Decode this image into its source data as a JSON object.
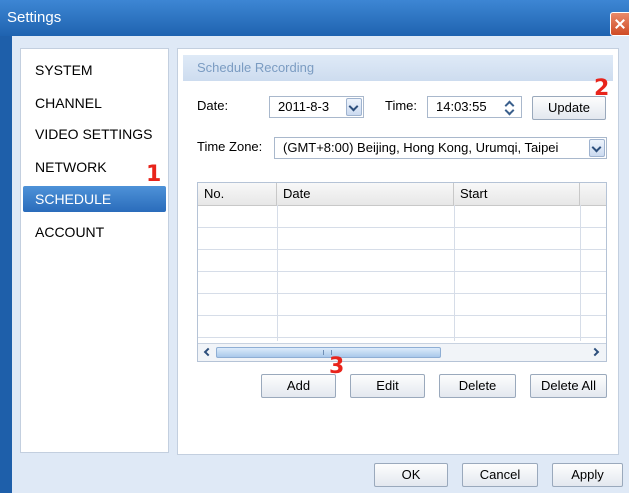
{
  "window": {
    "title": "Settings"
  },
  "sidebar": {
    "items": [
      {
        "label": "SYSTEM"
      },
      {
        "label": "CHANNEL"
      },
      {
        "label": "VIDEO SETTINGS"
      },
      {
        "label": "NETWORK"
      },
      {
        "label": "SCHEDULE",
        "active": true
      },
      {
        "label": "ACCOUNT"
      }
    ]
  },
  "panel": {
    "title": "Schedule Recording",
    "date_label": "Date:",
    "date_value": "2011-8-3",
    "time_label": "Time:",
    "time_value": "14:03:55",
    "update_label": "Update",
    "timezone_label": "Time Zone:",
    "timezone_value": "(GMT+8:00)  Beijing, Hong Kong, Urumqi, Taipei"
  },
  "table": {
    "columns": [
      "No.",
      "Date",
      "Start"
    ],
    "rows": []
  },
  "actions": {
    "add": "Add",
    "edit": "Edit",
    "delete": "Delete",
    "delete_all": "Delete All"
  },
  "footer": {
    "ok": "OK",
    "cancel": "Cancel",
    "apply": "Apply"
  },
  "annotations": {
    "marker_1": "1",
    "marker_2": "2",
    "marker_3": "3"
  },
  "colors": {
    "titlebar": "#2a6fbe",
    "selected": "#2f72c0",
    "marker": "#e8241b"
  },
  "icons": {
    "close": "close-icon",
    "dropdown": "chevron-down-icon",
    "spinner": "spinner-icon"
  }
}
